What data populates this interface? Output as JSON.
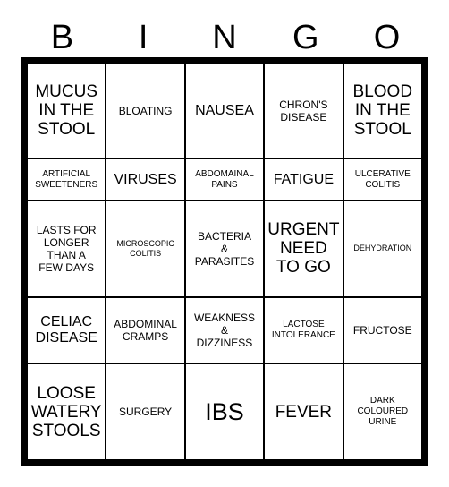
{
  "card": {
    "title": "BINGO",
    "header_letters": [
      "B",
      "I",
      "N",
      "G",
      "O"
    ],
    "colors": {
      "background": "#ffffff",
      "border": "#000000",
      "text": "#000000"
    },
    "grid": {
      "rows": 5,
      "columns": 5
    },
    "cells": [
      [
        {
          "text": "MUCUS\nIN THE\nSTOOL",
          "size": "lg"
        },
        {
          "text": "BLOATING",
          "size": "sm"
        },
        {
          "text": "NAUSEA",
          "size": "md"
        },
        {
          "text": "CHRON'S\nDISEASE",
          "size": "sm"
        },
        {
          "text": "BLOOD\nIN THE\nSTOOL",
          "size": "lg"
        }
      ],
      [
        {
          "text": "ARTIFICIAL\nSWEETENERS",
          "size": "xs"
        },
        {
          "text": "VIRUSES",
          "size": "md"
        },
        {
          "text": "ABDOMAINAL\nPAINS",
          "size": "xs"
        },
        {
          "text": "FATIGUE",
          "size": "md"
        },
        {
          "text": "ULCERATIVE\nCOLITIS",
          "size": "xs"
        }
      ],
      [
        {
          "text": "LASTS FOR\nLONGER\nTHAN A\nFEW DAYS",
          "size": "sm"
        },
        {
          "text": "MICROSCOPIC\nCOLITIS",
          "size": "xxs"
        },
        {
          "text": "BACTERIA\n&\nPARASITES",
          "size": "sm"
        },
        {
          "text": "URGENT\nNEED\nTO GO",
          "size": "lg"
        },
        {
          "text": "DEHYDRATION",
          "size": "xxs"
        }
      ],
      [
        {
          "text": "CELIAC\nDISEASE",
          "size": "md"
        },
        {
          "text": "ABDOMINAL\nCRAMPS",
          "size": "sm"
        },
        {
          "text": "WEAKNESS\n&\nDIZZINESS",
          "size": "sm"
        },
        {
          "text": "LACTOSE\nINTOLERANCE",
          "size": "xs"
        },
        {
          "text": "FRUCTOSE",
          "size": "sm"
        }
      ],
      [
        {
          "text": "LOOSE\nWATERY\nSTOOLS",
          "size": "lg"
        },
        {
          "text": "SURGERY",
          "size": "sm"
        },
        {
          "text": "IBS",
          "size": "xl"
        },
        {
          "text": "FEVER",
          "size": "lg"
        },
        {
          "text": "DARK\nCOLOURED\nURINE",
          "size": "xs"
        }
      ]
    ]
  }
}
